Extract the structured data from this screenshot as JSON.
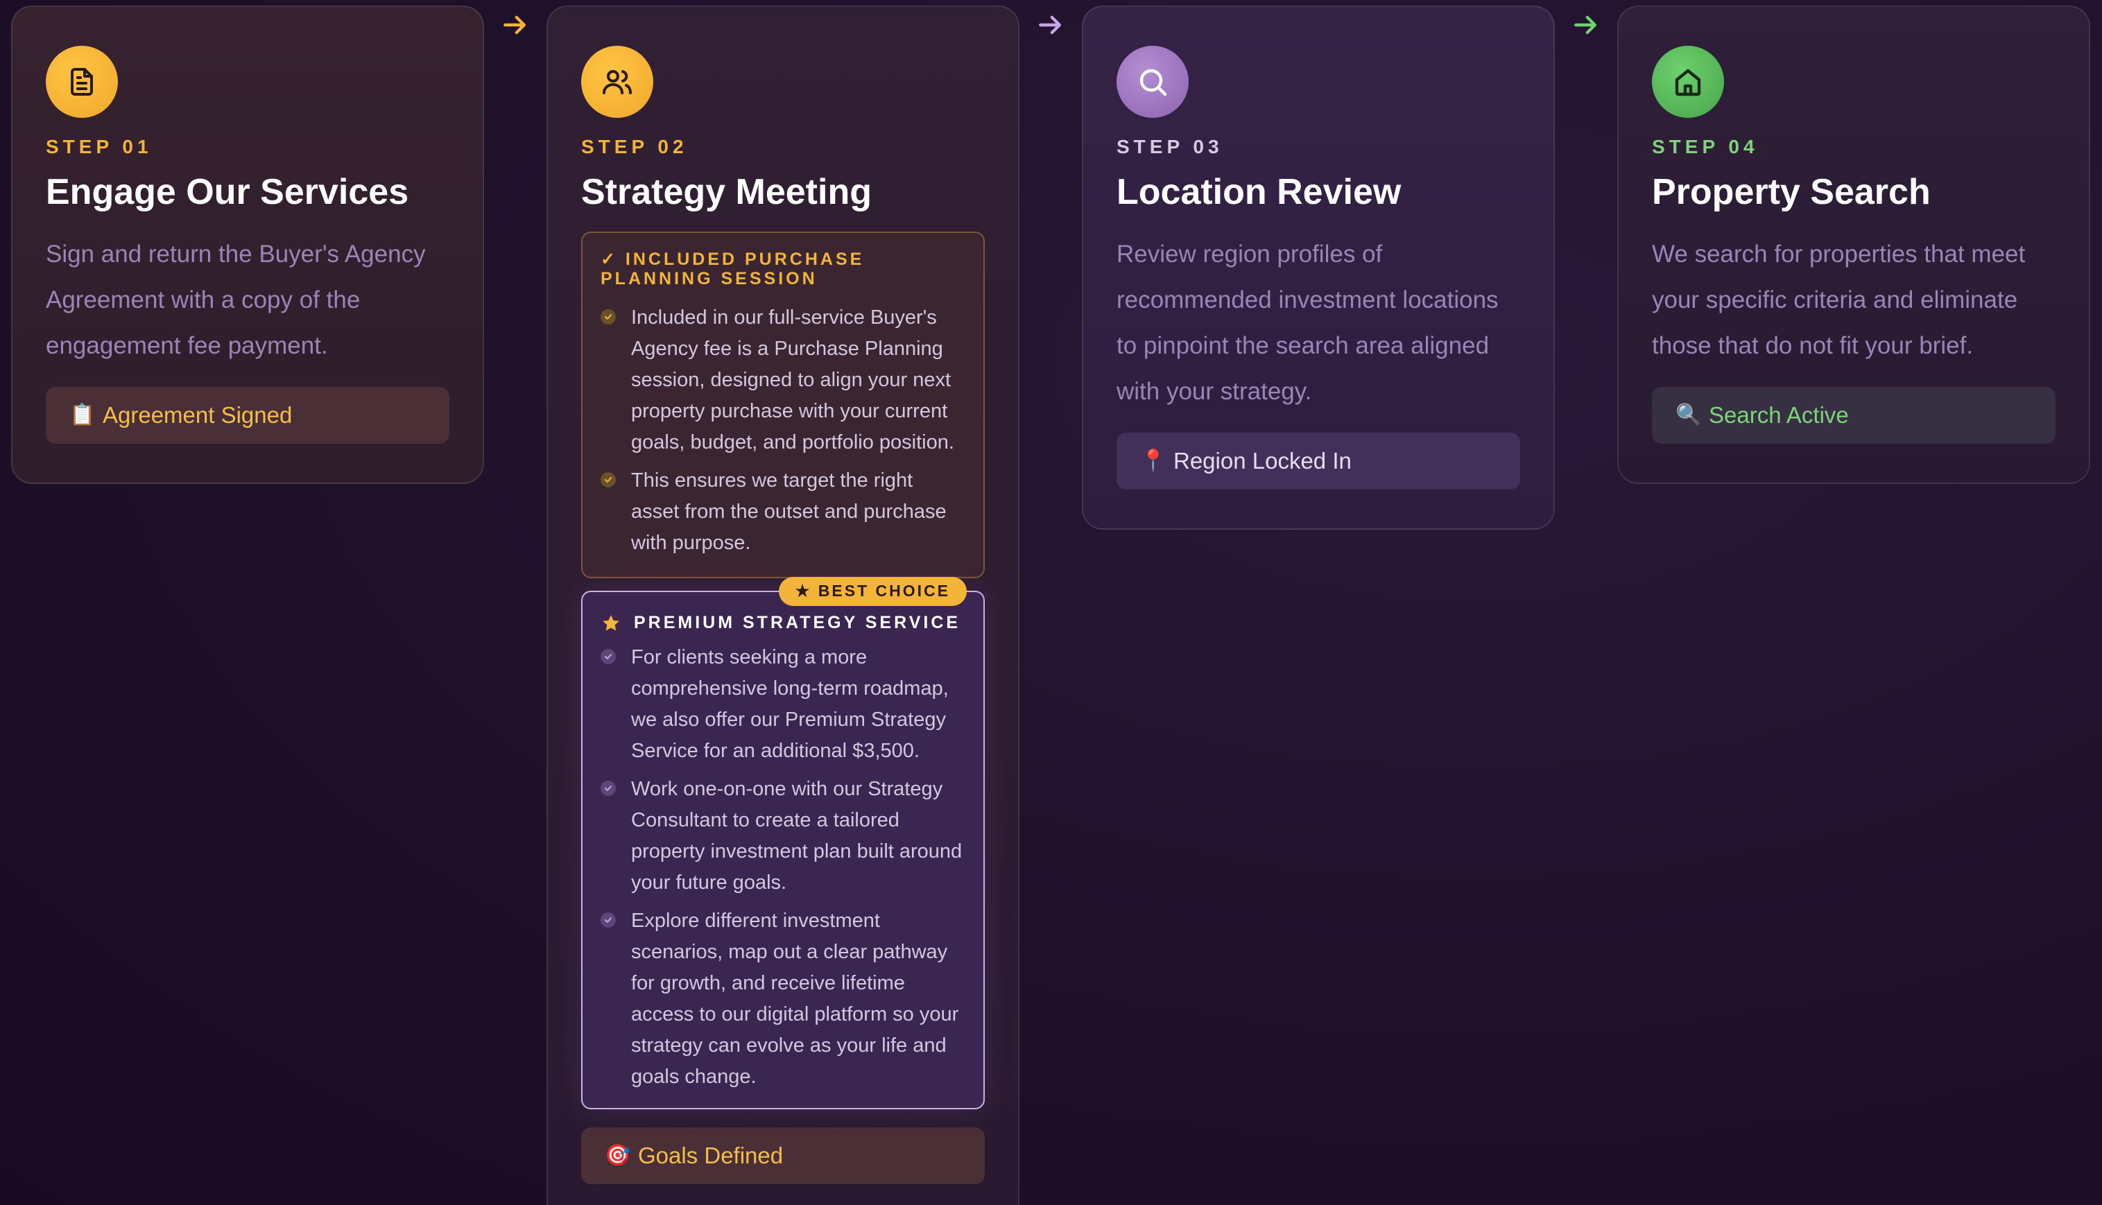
{
  "steps": [
    {
      "icon": "document-icon",
      "step": "STEP 01",
      "title": "Engage Our Services",
      "description": "Sign and return the Buyer's Agency Agreement with a copy of the engagement fee payment.",
      "badge": {
        "icon": "📋",
        "label": "Agreement Signed"
      }
    },
    {
      "icon": "users-icon",
      "step": "STEP 02",
      "title": "Strategy Meeting",
      "included": {
        "header": "✓ INCLUDED PURCHASE PLANNING SESSION",
        "items": [
          "Included in our full-service Buyer's Agency fee is a Purchase Planning session, designed to align your next property purchase with your current goals, budget, and portfolio position.",
          "This ensures we target the right asset from the outset and purchase with purpose."
        ]
      },
      "premium": {
        "badge": "★ BEST CHOICE",
        "header": "PREMIUM STRATEGY SERVICE",
        "items": [
          "For clients seeking a more comprehensive long-term roadmap, we also offer our Premium Strategy Service for an additional $3,500.",
          "Work one-on-one with our Strategy Consultant to create a tailored property investment plan built around your future goals.",
          "Explore different investment scenarios, map out a clear pathway for growth, and receive lifetime access to our digital platform so your strategy can evolve as your life and goals change."
        ]
      },
      "badge": {
        "icon": "🎯",
        "label": "Goals Defined"
      }
    },
    {
      "icon": "search-icon",
      "step": "STEP 03",
      "title": "Location Review",
      "description": "Review region profiles of recommended investment locations to pinpoint the search area aligned with your strategy.",
      "badge": {
        "icon": "📍",
        "label": "Region Locked In"
      }
    },
    {
      "icon": "home-icon",
      "step": "STEP 04",
      "title": "Property Search",
      "description": "We search for properties that meet your specific criteria and eliminate those that do not fit your brief.",
      "badge": {
        "icon": "🔍",
        "label": "Search Active"
      }
    }
  ],
  "colors": {
    "gold": "#f3b43a",
    "purple": "#8e62b3",
    "green": "#47a54a"
  }
}
